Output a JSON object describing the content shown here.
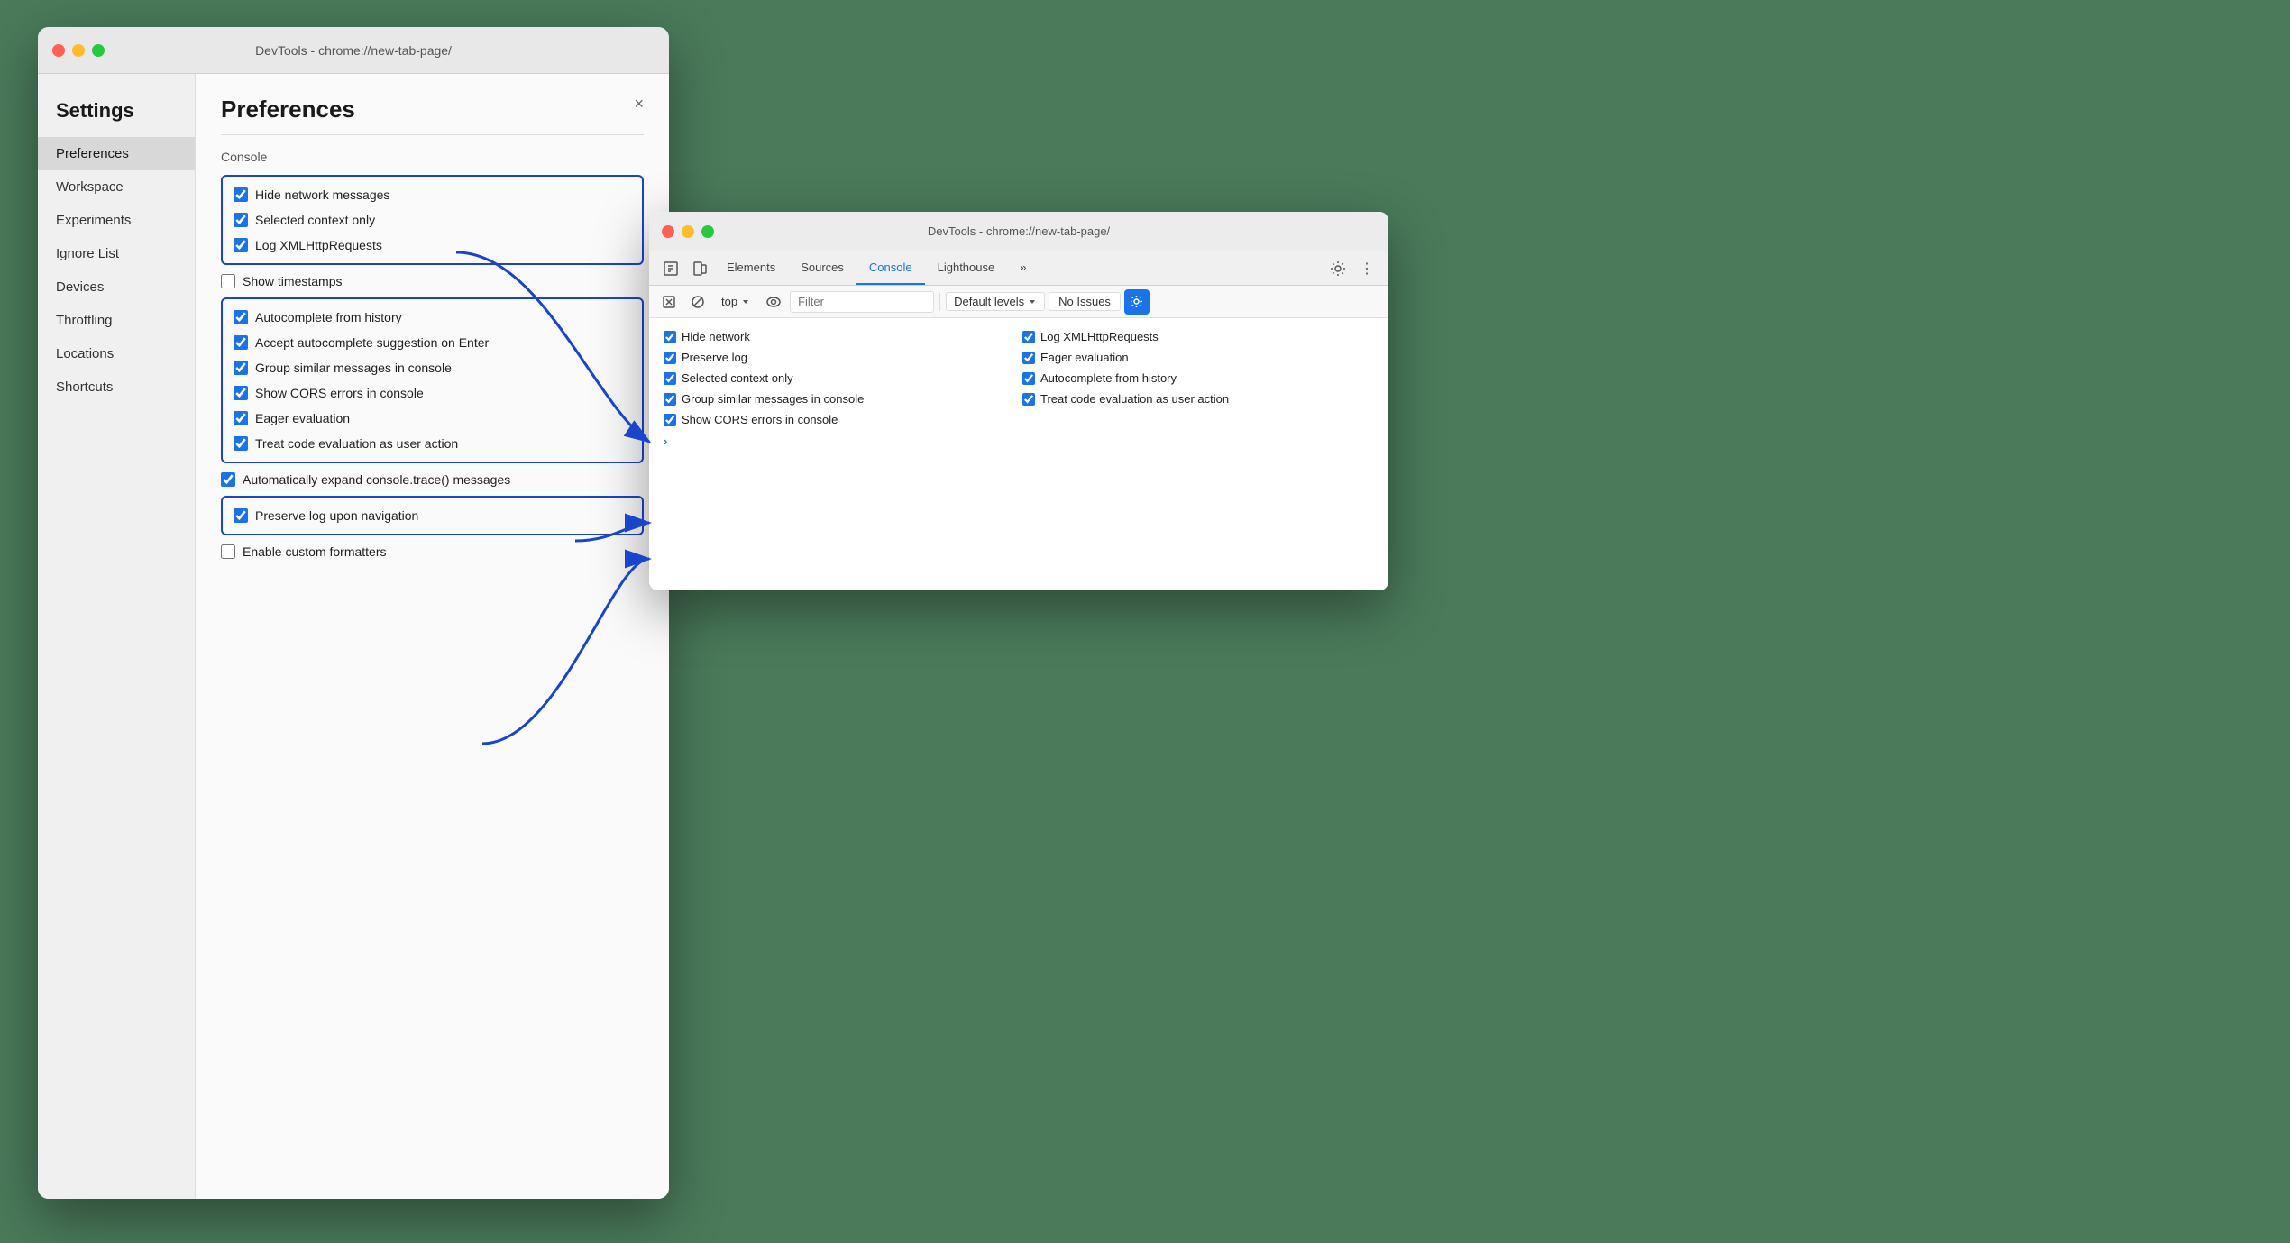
{
  "leftWindow": {
    "titlebar": "DevTools - chrome://new-tab-page/",
    "settings_heading": "Settings",
    "close_label": "×",
    "sidebar_items": [
      {
        "label": "Preferences",
        "active": true
      },
      {
        "label": "Workspace"
      },
      {
        "label": "Experiments"
      },
      {
        "label": "Ignore List"
      },
      {
        "label": "Devices"
      },
      {
        "label": "Throttling"
      },
      {
        "label": "Locations"
      },
      {
        "label": "Shortcuts"
      }
    ],
    "preferences_title": "Preferences",
    "section_console": "Console",
    "box1_items": [
      {
        "label": "Hide network messages",
        "checked": true
      },
      {
        "label": "Selected context only",
        "checked": true
      },
      {
        "label": "Log XMLHttpRequests",
        "checked": true
      }
    ],
    "no_box_item": {
      "label": "Show timestamps",
      "checked": false
    },
    "box2_items": [
      {
        "label": "Autocomplete from history",
        "checked": true
      },
      {
        "label": "Accept autocomplete suggestion on Enter",
        "checked": true
      },
      {
        "label": "Group similar messages in console",
        "checked": true
      },
      {
        "label": "Show CORS errors in console",
        "checked": true
      },
      {
        "label": "Eager evaluation",
        "checked": true
      },
      {
        "label": "Treat code evaluation as user action",
        "checked": true
      }
    ],
    "standalone_item": {
      "label": "Automatically expand console.trace() messages",
      "checked": true
    },
    "box3_item": {
      "label": "Preserve log upon navigation",
      "checked": true
    },
    "bottom_item": {
      "label": "Enable custom formatters",
      "checked": false
    }
  },
  "rightWindow": {
    "titlebar": "DevTools - chrome://new-tab-page/",
    "tabs": [
      {
        "label": "Elements"
      },
      {
        "label": "Sources"
      },
      {
        "label": "Console",
        "active": true
      },
      {
        "label": "Lighthouse"
      },
      {
        "label": "»"
      }
    ],
    "toolbar": {
      "top_label": "top",
      "filter_placeholder": "Filter",
      "default_levels_label": "Default levels",
      "no_issues_label": "No Issues"
    },
    "console_items_left": [
      {
        "label": "Hide network",
        "checked": true
      },
      {
        "label": "Preserve log",
        "checked": true
      },
      {
        "label": "Selected context only",
        "checked": true
      },
      {
        "label": "Group similar messages in console",
        "checked": true
      },
      {
        "label": "Show CORS errors in console",
        "checked": true
      }
    ],
    "console_items_right": [
      {
        "label": "Log XMLHttpRequests",
        "checked": true
      },
      {
        "label": "Eager evaluation",
        "checked": true
      },
      {
        "label": "Autocomplete from history",
        "checked": true
      },
      {
        "label": "Treat code evaluation as user action",
        "checked": true
      }
    ]
  }
}
